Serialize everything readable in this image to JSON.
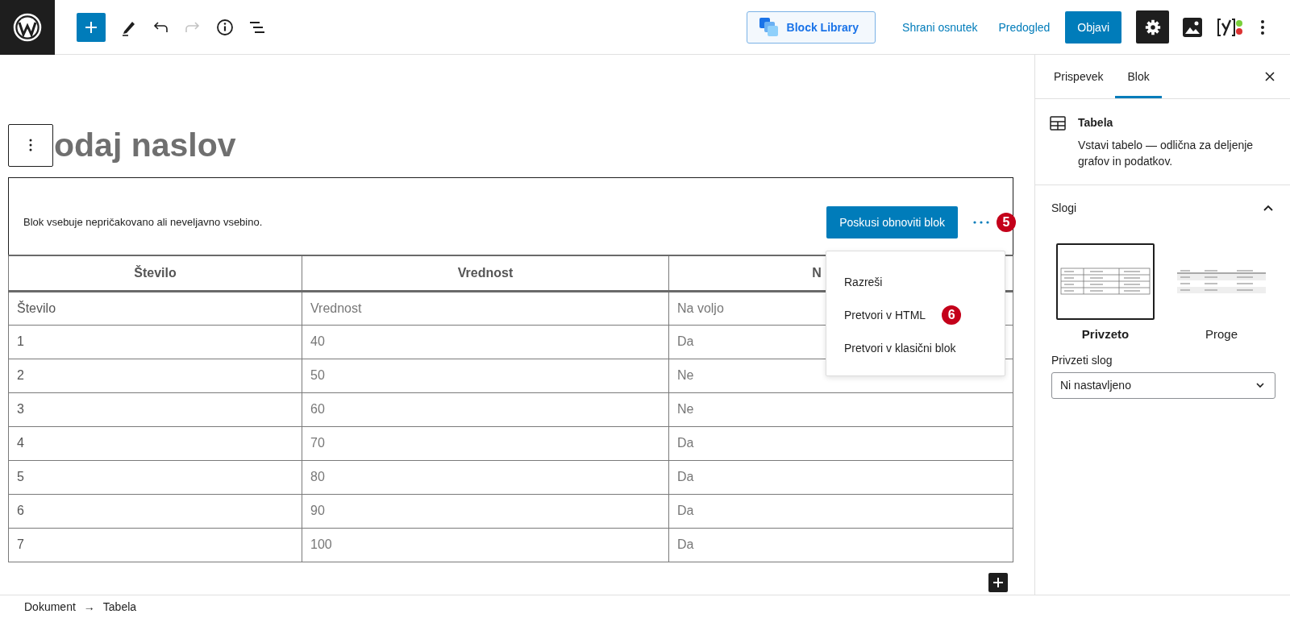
{
  "header": {
    "history": [
      {
        "kind": "undo",
        "disabled": false
      },
      {
        "kind": "redo",
        "disabled": true
      }
    ],
    "block_library": "Block Library",
    "save_draft": "Shrani osnutek",
    "preview": "Predogled",
    "publish": "Objavi",
    "settings": {
      "pressed": true
    }
  },
  "editor": {
    "title": "odaj naslov",
    "warning": {
      "message": "Blok vsebuje nepričakovano ali neveljavno vsebino.",
      "button": "Poskusi obnoviti blok",
      "badge": "5"
    },
    "menu": {
      "items": [
        {
          "label": "Razreši"
        },
        {
          "label": "Pretvori v HTML",
          "badge": "6"
        },
        {
          "label": "Pretvori v klasični blok"
        }
      ]
    },
    "table": {
      "columns": [
        "Število",
        "Vrednost",
        "N"
      ],
      "rows": [
        [
          "Število",
          "Vrednost",
          "Na voljo"
        ],
        [
          "1",
          "40",
          "Da"
        ],
        [
          "2",
          "50",
          "Ne"
        ],
        [
          "3",
          "60",
          "Ne"
        ],
        [
          "4",
          "70",
          "Da"
        ],
        [
          "5",
          "80",
          "Da"
        ],
        [
          "6",
          "90",
          "Da"
        ],
        [
          "7",
          "100",
          "Da"
        ]
      ]
    }
  },
  "sidebar": {
    "tabs": [
      {
        "label": "Prispevek",
        "selected": false
      },
      {
        "label": "Blok",
        "selected": true
      }
    ],
    "block": {
      "title": "Tabela",
      "description": "Vstavi tabelo — odlična za deljenje grafov in podatkov."
    },
    "styles": {
      "title": "Slogi",
      "expanded": true,
      "options": [
        {
          "label": "Privzeto",
          "kind": "regular",
          "selected": true
        },
        {
          "label": "Proge",
          "kind": "stripes",
          "selected": false
        }
      ],
      "default_label": "Privzeti slog",
      "default_value": "Ni nastavljeno"
    }
  },
  "breadcrumb": {
    "items": [
      "Dokument",
      "Tabela"
    ],
    "separator": "→"
  }
}
